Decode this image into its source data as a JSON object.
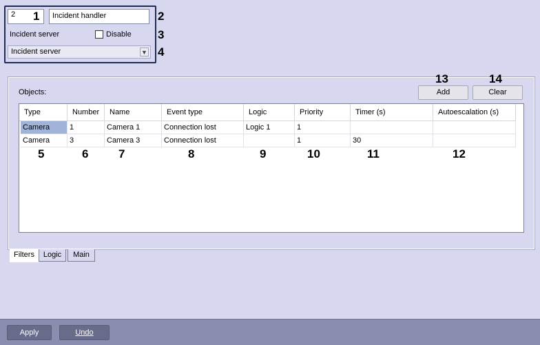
{
  "settings": {
    "id_value": "2",
    "name_value": "Incident handler",
    "server_label": "Incident server",
    "disable_label": "Disable",
    "server_select": "Incident server"
  },
  "panel": {
    "objects_label": "Objects:",
    "add_label": "Add",
    "clear_label": "Clear"
  },
  "table": {
    "columns": [
      "Type",
      "Number",
      "Name",
      "Event type",
      "Logic",
      "Priority",
      "Timer (s)",
      "Autoescalation (s)"
    ],
    "rows": [
      [
        "Camera",
        "1",
        "Camera 1",
        "Connection lost",
        "Logic 1",
        "1",
        "",
        ""
      ],
      [
        "Camera",
        "3",
        "Camera 3",
        "Connection lost",
        "",
        "1",
        "30",
        ""
      ]
    ]
  },
  "tabs": [
    "Filters",
    "Logic",
    "Main"
  ],
  "footer": {
    "apply_label": "Apply",
    "undo_label": "Undo"
  },
  "callouts": [
    "1",
    "2",
    "3",
    "4",
    "5",
    "6",
    "7",
    "8",
    "9",
    "10",
    "11",
    "12",
    "13",
    "14"
  ]
}
